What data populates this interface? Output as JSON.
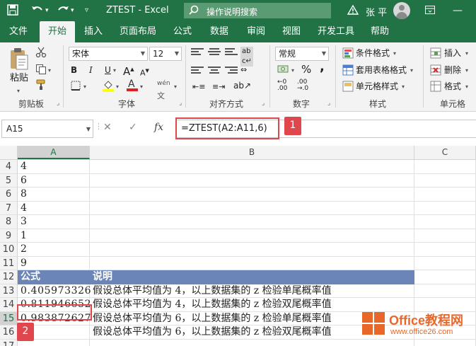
{
  "titlebar": {
    "title": "ZTEST  -  Excel",
    "tell_me": "操作说明搜索",
    "user": "张 平",
    "icons": [
      "save-icon",
      "undo-icon",
      "redo-icon",
      "customize-icon",
      "search-icon",
      "restore-window-icon",
      "avatar"
    ]
  },
  "tabs": [
    "文件",
    "开始",
    "插入",
    "页面布局",
    "公式",
    "数据",
    "审阅",
    "视图",
    "开发工具",
    "帮助"
  ],
  "active_tab": "开始",
  "ribbon": {
    "clipboard": {
      "paste": "粘贴",
      "label": "剪贴板"
    },
    "font": {
      "name": "宋体",
      "size": "12",
      "bold": "B",
      "italic": "I",
      "underline": "U",
      "grow": "A",
      "shrink": "A",
      "label": "字体",
      "phonetic": "wén"
    },
    "alignment": {
      "label": "对齐方式"
    },
    "number": {
      "format": "常规",
      "percent": "%",
      "comma": ",",
      "label": "数字"
    },
    "styles": {
      "conditional": "条件格式",
      "table": "套用表格格式",
      "cell": "单元格样式",
      "label": "样式"
    },
    "cells": {
      "insert": "插入",
      "delete": "删除",
      "format": "格式",
      "label": "单元格"
    }
  },
  "formula_bar": {
    "name_box": "A15",
    "cancel": "✕",
    "enter": "✓",
    "fx": "fx",
    "formula": "=ZTEST(A2:A11,6)"
  },
  "grid": {
    "columns": [
      "A",
      "B",
      "C"
    ],
    "selected_column": "A",
    "selected_row": "15",
    "rows": [
      {
        "num": "4",
        "a": "4",
        "b": ""
      },
      {
        "num": "5",
        "a": "6",
        "b": ""
      },
      {
        "num": "6",
        "a": "8",
        "b": ""
      },
      {
        "num": "7",
        "a": "4",
        "b": ""
      },
      {
        "num": "8",
        "a": "3",
        "b": ""
      },
      {
        "num": "9",
        "a": "1",
        "b": ""
      },
      {
        "num": "10",
        "a": "2",
        "b": ""
      },
      {
        "num": "11",
        "a": "9",
        "b": ""
      },
      {
        "num": "12",
        "a": "公式",
        "b": "说明",
        "header": true
      },
      {
        "num": "13",
        "a": "0.405973326",
        "b": "假设总体平均值为 4，以上数据集的 z 检验单尾概率值"
      },
      {
        "num": "14",
        "a": "0.811946652",
        "b": "假设总体平均值为 4，以上数据集的 z 检验双尾概率值"
      },
      {
        "num": "15",
        "a": "0.983872627",
        "b": "假设总体平均值为 6，以上数据集的 z 检验单尾概率值"
      },
      {
        "num": "16",
        "a": "",
        "b": "假设总体平均值为 6，以上数据集的 z 检验双尾概率值"
      },
      {
        "num": "17",
        "a": "",
        "b": ""
      }
    ]
  },
  "callouts": {
    "one": "1",
    "two": "2"
  },
  "colors": {
    "excel_green": "#217346",
    "header_fill": "#6b85b8",
    "callout_red": "#e0474c",
    "watermark_orange": "#e8682a"
  },
  "watermark": {
    "name": "Office教程网",
    "url": "www.office26.com"
  }
}
